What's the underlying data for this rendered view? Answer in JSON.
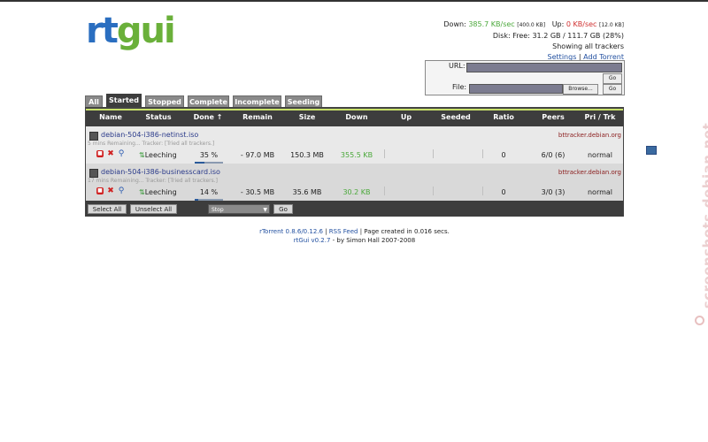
{
  "logo": {
    "part1": "rt",
    "part2": "gui"
  },
  "stats": {
    "down_label": "Down:",
    "down_value": "385.7 KB/sec",
    "down_limit": "[400.0 KB]",
    "up_label": "Up:",
    "up_value": "0 KB/sec",
    "up_limit": "[12.0 KB]",
    "disk": "Disk: Free: 31.2 GB / 111.7 GB (28%)",
    "showing": "Showing all trackers",
    "settings": "Settings",
    "sep": "|",
    "add_torrent": "Add Torrent"
  },
  "add": {
    "url_label": "URL:",
    "file_label": "File:",
    "go": "Go",
    "browse": "Browse..."
  },
  "tabs": [
    "All",
    "Started",
    "Stopped",
    "Complete",
    "Incomplete",
    "Seeding"
  ],
  "columns": [
    "Name",
    "Status",
    "Done ↑",
    "Remain",
    "Size",
    "Down",
    "Up",
    "Seeded",
    "Ratio",
    "Peers",
    "Pri / Trk"
  ],
  "rows": [
    {
      "name": "debian-504-i386-netinst.iso",
      "tracker": "bttracker.debian.org",
      "remaining": "5 mins Remaining... Tracker: [Tried all trackers.]",
      "status": "Leeching",
      "done": "35 %",
      "progress": 0.35,
      "remain": "- 97.0 MB",
      "size": "150.3 MB",
      "down": "355.5 KB",
      "up": "",
      "seeded": "",
      "ratio": "0",
      "peers": "6/0 (6)",
      "pri": "normal"
    },
    {
      "name": "debian-504-i386-businesscard.iso",
      "tracker": "bttracker.debian.org",
      "remaining": "17 mins Remaining... Tracker: [Tried all trackers.]",
      "status": "Leeching",
      "done": "14 %",
      "progress": 0.14,
      "remain": "- 30.5 MB",
      "size": "35.6 MB",
      "down": "30.2 KB",
      "up": "",
      "seeded": "",
      "ratio": "0",
      "peers": "3/0 (3)",
      "pri": "normal"
    }
  ],
  "bottom": {
    "select_all": "Select All",
    "unselect_all": "Unselect All",
    "action": "Stop",
    "go": "Go"
  },
  "footer": {
    "rtorrent": "rTorrent 0.8.6/0.12.6",
    "sep": "|",
    "rss": "RSS Feed",
    "created": "| Page created in 0.016 secs.",
    "rtgui": "rtGui v0.2.7",
    "by": "- by Simon Hall 2007-2008"
  },
  "watermark": "screenshots.debian.net"
}
